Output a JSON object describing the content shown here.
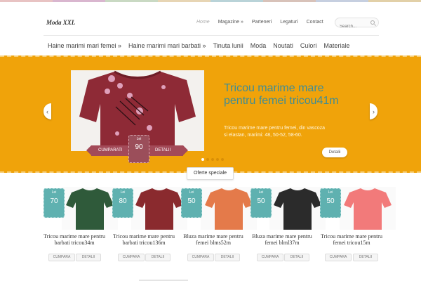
{
  "stripe_colors": [
    "#e8c3c3",
    "#d9b6cf",
    "#c9d9c3",
    "#e7d5b4",
    "#b9d3d8",
    "#d8c2b9",
    "#c6cfe0",
    "#e2d0a8"
  ],
  "site": {
    "logo": "Moda XXL"
  },
  "top_nav": {
    "items": [
      "Home",
      "Magazine »",
      "Parteneri",
      "Legaturi",
      "Contact"
    ],
    "active_index": 0
  },
  "search": {
    "placeholder": "Search..."
  },
  "category_nav": {
    "items": [
      "Haine marimi mari femei »",
      "Haine marimi mari barbati »",
      "Tinuta lunii",
      "Moda",
      "Noutati",
      "Culori",
      "Materiale"
    ]
  },
  "slider": {
    "accent_color": "#f0a30a",
    "title": "Tricou marime mare pentru femei tricou41m",
    "description": "Tricou marime mare pentru femei, din vascoza si elastan, marimi: 48, 50-52, 58-60.",
    "details_label": "Detalii",
    "buy_label": "CUMPARATI",
    "ribbon_details_label": "DETALII",
    "currency": "Lei",
    "price": "90",
    "dots_count": 5,
    "active_dot": 0
  },
  "offers_button": "Oferte speciale",
  "products": [
    {
      "price": "70",
      "currency": "Lei",
      "title": "Tricou marime mare pentru barbati tricou34m",
      "buy": "CUMPARA",
      "details": "DETALII",
      "color": "#2f5a3a"
    },
    {
      "price": "80",
      "currency": "Lei",
      "title": "Tricou marime mare pentru barbati tricou136m",
      "buy": "CUMPARA",
      "details": "DETALII",
      "color": "#8a2a2e"
    },
    {
      "price": "50",
      "currency": "Lei",
      "title": "Bluza marime mare pentru femei blms52m",
      "buy": "CUMPARA",
      "details": "DETALII",
      "color": "#e47a4a"
    },
    {
      "price": "50",
      "currency": "Lei",
      "title": "Bluza marime mare pentru femei blml37m",
      "buy": "CUMPARA",
      "details": "DETALII",
      "color": "#2b2b2b"
    },
    {
      "price": "50",
      "currency": "Lei",
      "title": "Tricou marime mare pentru femei tricou15m",
      "buy": "CUMPARA",
      "details": "DETALII",
      "color": "#f27a7a"
    }
  ]
}
